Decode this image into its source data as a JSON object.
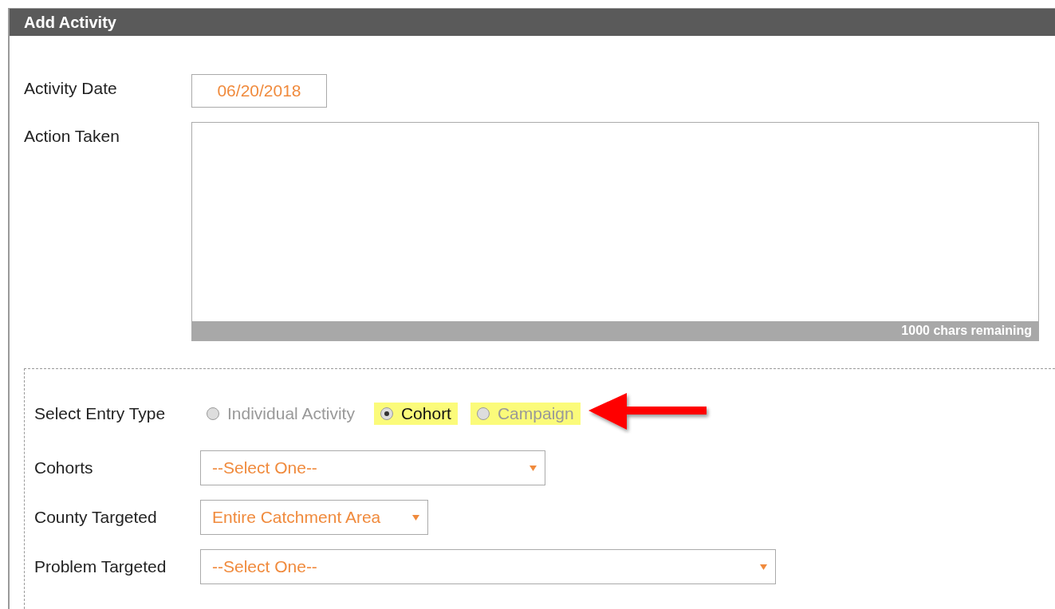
{
  "panel": {
    "title": "Add Activity"
  },
  "activity_date": {
    "label": "Activity Date",
    "value": "06/20/2018"
  },
  "action_taken": {
    "label": "Action Taken",
    "counter": "1000 chars remaining"
  },
  "entry_type": {
    "label": "Select Entry Type",
    "options": [
      {
        "label": "Individual Activity",
        "selected": false,
        "highlighted": false
      },
      {
        "label": "Cohort",
        "selected": true,
        "highlighted": true
      },
      {
        "label": "Campaign",
        "selected": false,
        "highlighted": true
      }
    ]
  },
  "selects": [
    {
      "label": "Cohorts",
      "value": "--Select One--"
    },
    {
      "label": "County Targeted",
      "value": "Entire Catchment Area"
    },
    {
      "label": "Problem Targeted",
      "value": "--Select One--"
    }
  ]
}
